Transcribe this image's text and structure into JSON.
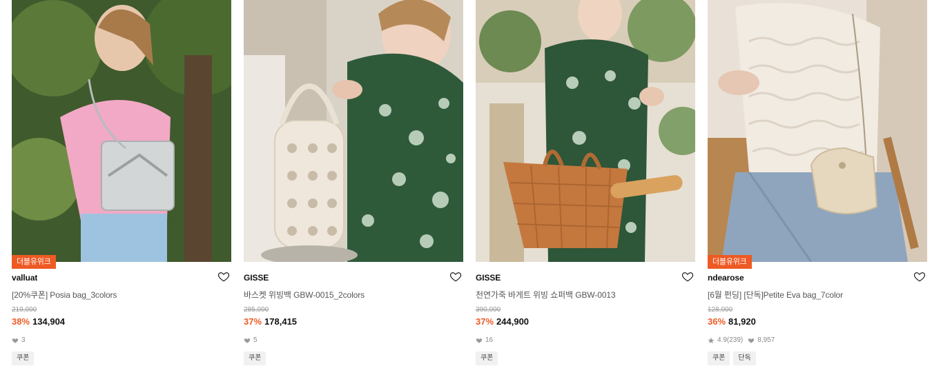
{
  "products": [
    {
      "badge": "더블유위크",
      "brand": "valluat",
      "name": "[20%쿠폰] Posia bag_3colors",
      "original_price": "219,000",
      "discount": "38%",
      "price": "134,904",
      "rating": "",
      "likes": "3",
      "tags": [
        "쿠폰"
      ]
    },
    {
      "badge": "",
      "brand": "GISSE",
      "name": "바스켓 위빙백 GBW-0015_2colors",
      "original_price": "285,000",
      "discount": "37%",
      "price": "178,415",
      "rating": "",
      "likes": "5",
      "tags": [
        "쿠폰"
      ]
    },
    {
      "badge": "",
      "brand": "GISSE",
      "name": "천연가죽 바게트 위빙 쇼퍼백 GBW-0013",
      "original_price": "390,000",
      "discount": "37%",
      "price": "244,900",
      "rating": "",
      "likes": "16",
      "tags": [
        "쿠폰"
      ]
    },
    {
      "badge": "더블유위크",
      "brand": "ndearose",
      "name": "[6월 펀딩] [단독]Petite Eva bag_7color",
      "original_price": "128,000",
      "discount": "36%",
      "price": "81,920",
      "rating": "4.9",
      "review_count": "(239)",
      "likes": "8,957",
      "tags": [
        "쿠폰",
        "단독"
      ]
    }
  ],
  "icons": {
    "wishlist": "heart-outline-icon",
    "likes": "heart-filled-icon",
    "rating": "star-icon"
  },
  "colors": {
    "accent": "#ee5a24",
    "tag_bg": "#f1f1f1",
    "muted": "#888888"
  }
}
